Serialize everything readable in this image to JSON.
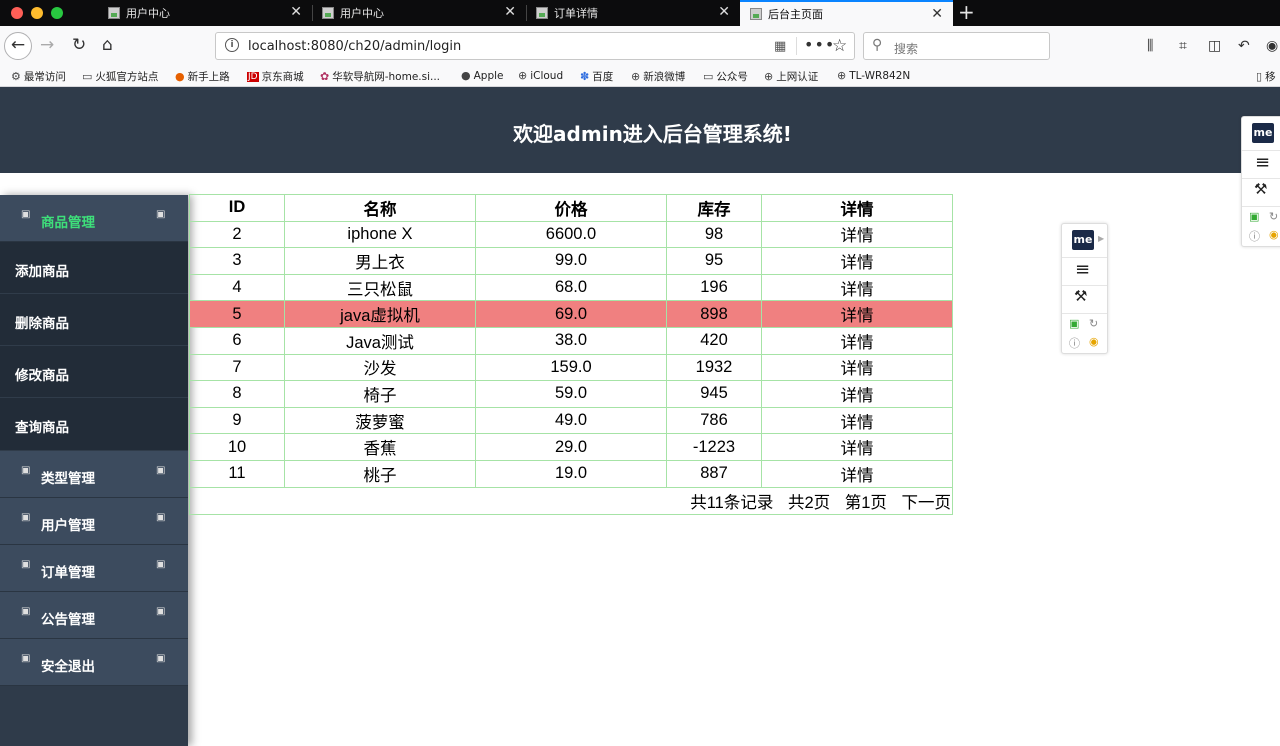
{
  "browser": {
    "tabs": [
      {
        "label": "用户中心"
      },
      {
        "label": "用户中心"
      },
      {
        "label": "订单详情"
      },
      {
        "label": "后台主页面"
      }
    ],
    "url": "localhost:8080/ch20/admin/login",
    "search_placeholder": "搜索",
    "bookmarks": [
      "最常访问",
      "火狐官方站点",
      "新手上路",
      "京东商城",
      "华软导航网-home.si...",
      "Apple",
      "iCloud",
      "百度",
      "新浪微博",
      "公众号",
      "上网认证",
      "TL-WR842N"
    ],
    "bookmark_right": "移"
  },
  "header": {
    "title": "欢迎admin进入后台管理系统!"
  },
  "sidebar": {
    "groups": [
      {
        "label": "商品管理",
        "active": true
      },
      {
        "label": "类型管理"
      },
      {
        "label": "用户管理"
      },
      {
        "label": "订单管理"
      },
      {
        "label": "公告管理"
      },
      {
        "label": "安全退出"
      }
    ],
    "sub_items": [
      "添加商品",
      "删除商品",
      "修改商品",
      "查询商品"
    ]
  },
  "table": {
    "columns": [
      "ID",
      "名称",
      "价格",
      "库存",
      "详情"
    ],
    "rows": [
      [
        "2",
        "iphone X",
        "6600.0",
        "98",
        "详情"
      ],
      [
        "3",
        "男上衣",
        "99.0",
        "95",
        "详情"
      ],
      [
        "4",
        "三只松鼠",
        "68.0",
        "196",
        "详情"
      ],
      [
        "5",
        "java虚拟机",
        "69.0",
        "898",
        "详情"
      ],
      [
        "6",
        "Java测试",
        "38.0",
        "420",
        "详情"
      ],
      [
        "7",
        "沙发",
        "159.0",
        "1932",
        "详情"
      ],
      [
        "8",
        "椅子",
        "59.0",
        "945",
        "详情"
      ],
      [
        "9",
        "菠萝蜜",
        "49.0",
        "786",
        "详情"
      ],
      [
        "10",
        "香蕉",
        "29.0",
        "-1223",
        "详情"
      ],
      [
        "11",
        "桃子",
        "19.0",
        "887",
        "详情"
      ]
    ],
    "highlight_row_id": "5",
    "highlight_color": "#f08080",
    "pager": {
      "total": "共11条记录",
      "pages": "共2页",
      "current": "第1页",
      "next": "下一页"
    }
  },
  "extension": {
    "badge": "me"
  }
}
